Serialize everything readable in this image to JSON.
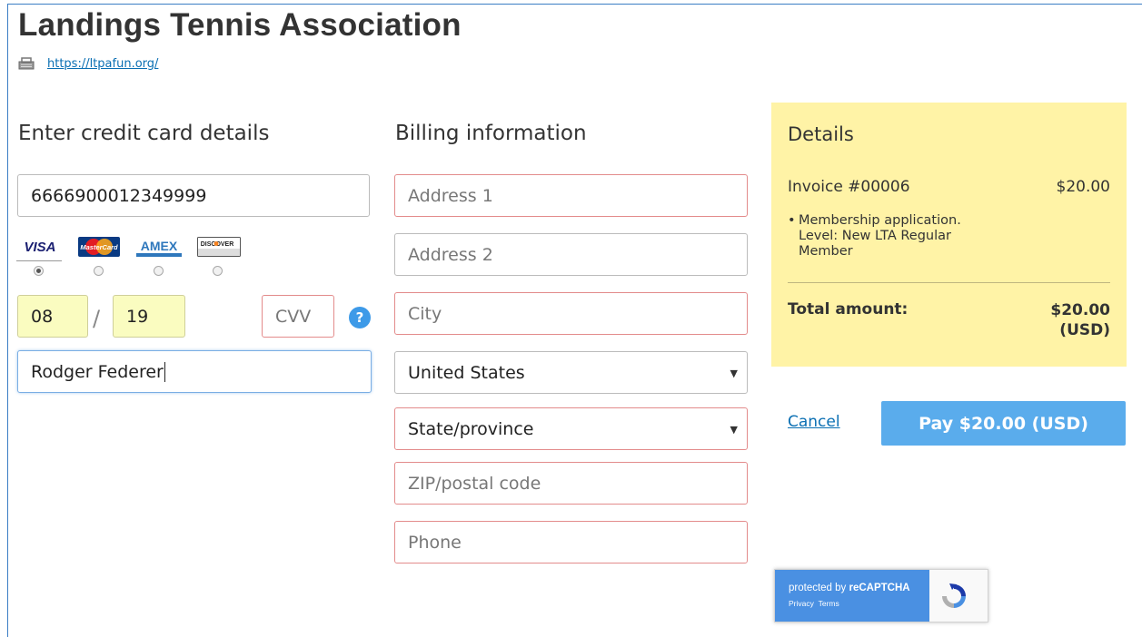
{
  "org": {
    "title": "Landings Tennis Association",
    "url": "https://ltpafun.org/"
  },
  "card": {
    "heading": "Enter credit card details",
    "number": "6666900012349999",
    "brands": [
      "VISA",
      "MasterCard",
      "AMEX",
      "DISCOVER"
    ],
    "selected_brand": "VISA",
    "exp_month": "08",
    "exp_separator": "/",
    "exp_year": "19",
    "cvv_placeholder": "CVV",
    "help_icon_glyph": "?",
    "name_on_card": "Rodger Federer"
  },
  "billing": {
    "heading": "Billing information",
    "address1_placeholder": "Address 1",
    "address2_placeholder": "Address 2",
    "city_placeholder": "City",
    "country": "United States",
    "state_placeholder": "State/province",
    "zip_placeholder": "ZIP/postal code",
    "phone_placeholder": "Phone"
  },
  "details": {
    "title": "Details",
    "invoice_label": "Invoice #00006",
    "invoice_amount": "$20.00",
    "line_item": "Membership application. Level: New LTA Regular Member",
    "total_label": "Total amount:",
    "total_amount": "$20.00",
    "total_currency": "(USD)"
  },
  "actions": {
    "cancel_label": "Cancel",
    "pay_label": "Pay $20.00 (USD)"
  },
  "recaptcha": {
    "prefix": "protected by ",
    "brand": "reCAPTCHA",
    "privacy": "Privacy",
    "terms": "Terms"
  },
  "colors": {
    "accent_blue": "#5aacec",
    "link_blue": "#0a6fb3",
    "invalid_border": "#e38b8b",
    "details_bg": "#fff3a6",
    "autofill_yellow": "#fafcc0"
  }
}
